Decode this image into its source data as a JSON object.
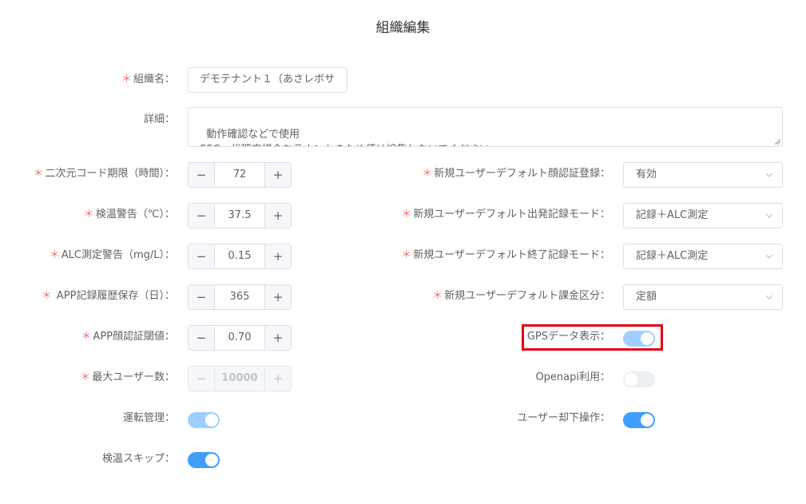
{
  "page": {
    "title": "組織編集"
  },
  "colors": {
    "primary": "#409eff",
    "required": "#f56c6c",
    "highlight": "#e60012"
  },
  "fields": {
    "org_name": {
      "required": true,
      "label": "組織名：",
      "value": "デモテナント１（あさレボサ"
    },
    "details": {
      "required": false,
      "label": "詳細：",
      "value": "動作確認などで使用\nSSC、代理店様含むテナントのため値は編集しないでください。"
    },
    "qr_expiry": {
      "required": true,
      "label": "二次元コード期限（時間）：",
      "value": "72",
      "minus": "−",
      "plus": "+"
    },
    "temp_warning": {
      "required": true,
      "label": "検温警告（℃）：",
      "value": "37.5",
      "minus": "−",
      "plus": "+"
    },
    "alc_warning": {
      "required": true,
      "label": "ALC測定警告（mg/L）：",
      "value": "0.15",
      "minus": "−",
      "plus": "+"
    },
    "app_history": {
      "required": true,
      "label": " APP記録履歴保存（日）：",
      "value": "365",
      "minus": "−",
      "plus": "+"
    },
    "face_threshold": {
      "required": true,
      "label": "APP顔認証閾値：",
      "value": "0.70",
      "minus": "−",
      "plus": "+"
    },
    "max_users": {
      "required": true,
      "label": "最大ユーザー数：",
      "value": "10000",
      "minus": "−",
      "plus": "+",
      "disabled": true
    },
    "driving_mgmt": {
      "required": false,
      "label": "運転管理：",
      "on": true
    },
    "temp_skip": {
      "required": false,
      "label": "検温スキップ：",
      "on": true
    },
    "default_face_reg": {
      "required": true,
      "label": "新規ユーザーデフォルト顔認証登録：",
      "value": "有効"
    },
    "default_departure_mode": {
      "required": true,
      "label": "新規ユーザーデフォルト出発記録モード：",
      "value": "記録＋ALC測定"
    },
    "default_end_mode": {
      "required": true,
      "label": "新規ユーザーデフォルト終了記録モード：",
      "value": "記録＋ALC測定"
    },
    "default_billing": {
      "required": true,
      "label": "新規ユーザーデフォルト課金区分：",
      "value": "定額"
    },
    "gps_display": {
      "required": false,
      "label": "GPSデータ表示：",
      "on": true
    },
    "openapi": {
      "required": false,
      "label": "Openapi利用：",
      "on": false
    },
    "user_reject": {
      "required": false,
      "label": "ユーザー却下操作：",
      "on": true
    }
  },
  "required_mark": "＊"
}
